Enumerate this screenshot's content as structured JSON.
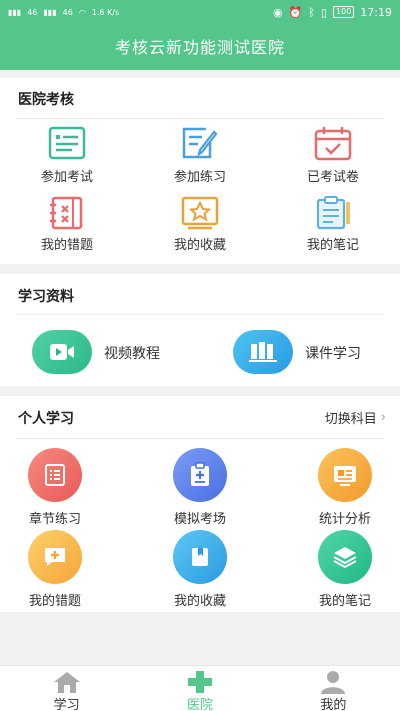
{
  "status_bar": {
    "left_signal_1": "46",
    "left_signal_2": "46",
    "speed": "1.6 K/s",
    "battery": "100",
    "time": "17:19"
  },
  "header": {
    "title": "考核云新功能测试医院"
  },
  "hospital_exam": {
    "title": "医院考核",
    "items": [
      {
        "label": "参加考试",
        "icon": "exam-list-icon"
      },
      {
        "label": "参加练习",
        "icon": "practice-edit-icon"
      },
      {
        "label": "已考试卷",
        "icon": "calendar-check-icon"
      },
      {
        "label": "我的错题",
        "icon": "wrong-book-icon"
      },
      {
        "label": "我的收藏",
        "icon": "star-folder-icon"
      },
      {
        "label": "我的笔记",
        "icon": "notebook-icon"
      }
    ]
  },
  "study_materials": {
    "title": "学习资料",
    "items": [
      {
        "label": "视频教程",
        "icon": "video-icon"
      },
      {
        "label": "课件学习",
        "icon": "books-icon"
      }
    ]
  },
  "personal_study": {
    "title": "个人学习",
    "switch_label": "切换科目",
    "items": [
      {
        "label": "章节练习",
        "icon": "chapter-list-icon"
      },
      {
        "label": "模拟考场",
        "icon": "clipboard-plus-icon"
      },
      {
        "label": "统计分析",
        "icon": "stats-card-icon"
      },
      {
        "label": "我的错题",
        "icon": "chat-plus-icon"
      },
      {
        "label": "我的收藏",
        "icon": "bookmark-icon"
      },
      {
        "label": "我的笔记",
        "icon": "layers-icon"
      }
    ]
  },
  "tabbar": {
    "tabs": [
      {
        "label": "学习",
        "icon": "home-icon"
      },
      {
        "label": "医院",
        "icon": "cross-icon"
      },
      {
        "label": "我的",
        "icon": "user-icon"
      }
    ]
  },
  "colors": {
    "brand": "#55c68b",
    "exam_icon": "#3cb89a",
    "practice_icon": "#4a9fe0",
    "done_icon": "#e86a6a",
    "wrong_icon": "#e86a6a",
    "fav_icon": "#e6a23c",
    "note_icon": "#5fb0e0"
  }
}
